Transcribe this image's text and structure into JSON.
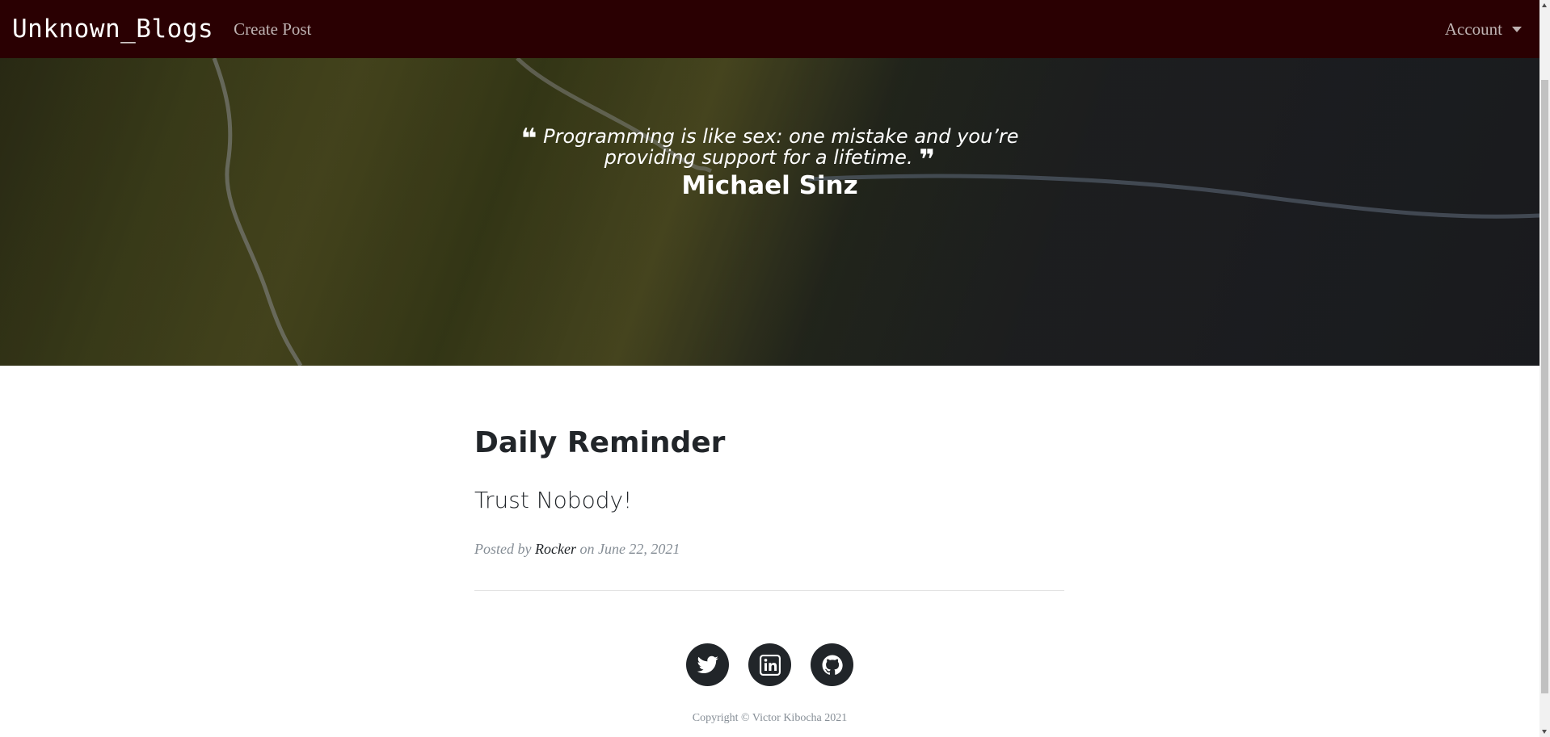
{
  "navbar": {
    "brand": "Unknown_Blogs",
    "create_post": "Create Post",
    "account": "Account"
  },
  "hero": {
    "quote": "Programming is like sex: one mistake and you’re providing support for a lifetime.",
    "author": "Michael Sinz"
  },
  "post": {
    "title": "Daily Reminder",
    "subtitle": "Trust Nobody!",
    "posted_by_label": "Posted by",
    "author": "Rocker",
    "on_label": "on",
    "date": "June 22, 2021"
  },
  "footer": {
    "social_icons": [
      "twitter-icon",
      "linkedin-icon",
      "github-icon"
    ],
    "copyright": "Copyright © Victor Kibocha 2021"
  },
  "colors": {
    "navbar_bg": "#2a0002",
    "social_circle": "#212529",
    "meta_text": "#868e96"
  }
}
